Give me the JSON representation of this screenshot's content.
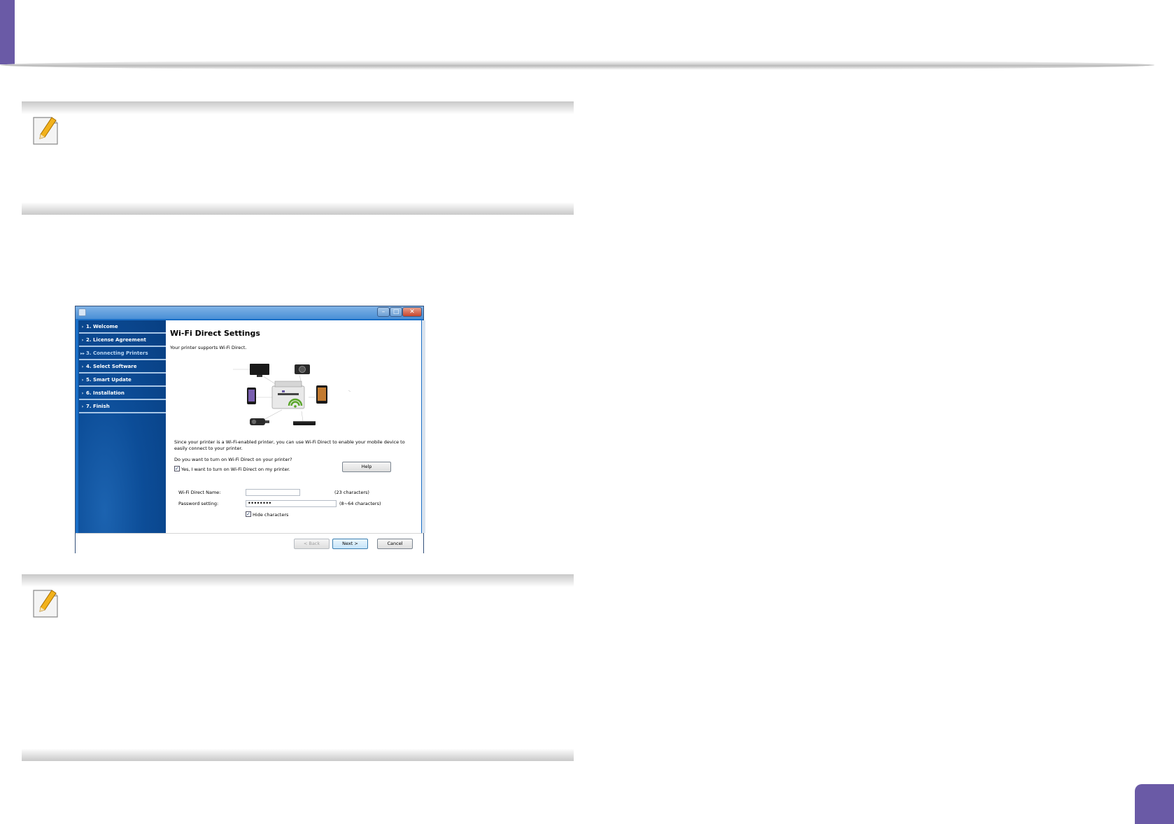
{
  "dialog": {
    "steps": [
      {
        "arrow": "›",
        "label": "1. Welcome"
      },
      {
        "arrow": "›",
        "label": "2. License Agreement"
      },
      {
        "arrow": "▸▸",
        "label": "3. Connecting Printers"
      },
      {
        "arrow": "›",
        "label": "4. Select Software"
      },
      {
        "arrow": "›",
        "label": "5. Smart Update"
      },
      {
        "arrow": "›",
        "label": "6. Installation"
      },
      {
        "arrow": "›",
        "label": "7. Finish"
      }
    ],
    "title": "Wi-Fi Direct Settings",
    "subtitle": "Your printer supports Wi-Fi Direct.",
    "description_line1": "Since your printer is a Wi-Fi-enabled printer, you can use Wi-Fi Direct to enable your mobile device to",
    "description_line2": "easily connect to your printer.",
    "question": "Do you want to turn on Wi-Fi Direct on your printer?",
    "enable_checkbox_label": "Yes, I want to turn on Wi-Fi Direct on my printer.",
    "help_button": "Help",
    "name_label": "Wi-Fi Direct Name:",
    "name_value": "",
    "name_hint": "(23 characters)",
    "password_label": "Password setting:",
    "password_value": "••••••••",
    "password_hint": "(8~64 characters)",
    "hide_label": "Hide characters",
    "back_button": "< Back",
    "next_button": "Next >",
    "cancel_button": "Cancel",
    "minimize_glyph": "–",
    "maximize_glyph": "□",
    "close_glyph": "✕",
    "checkmark": "✓",
    "enable_checked": true,
    "hide_checked": true
  },
  "colors": {
    "accent": "#6a5aa6",
    "dialog_panel": "#0c4d98",
    "wifi_green": "#5aa62a"
  }
}
